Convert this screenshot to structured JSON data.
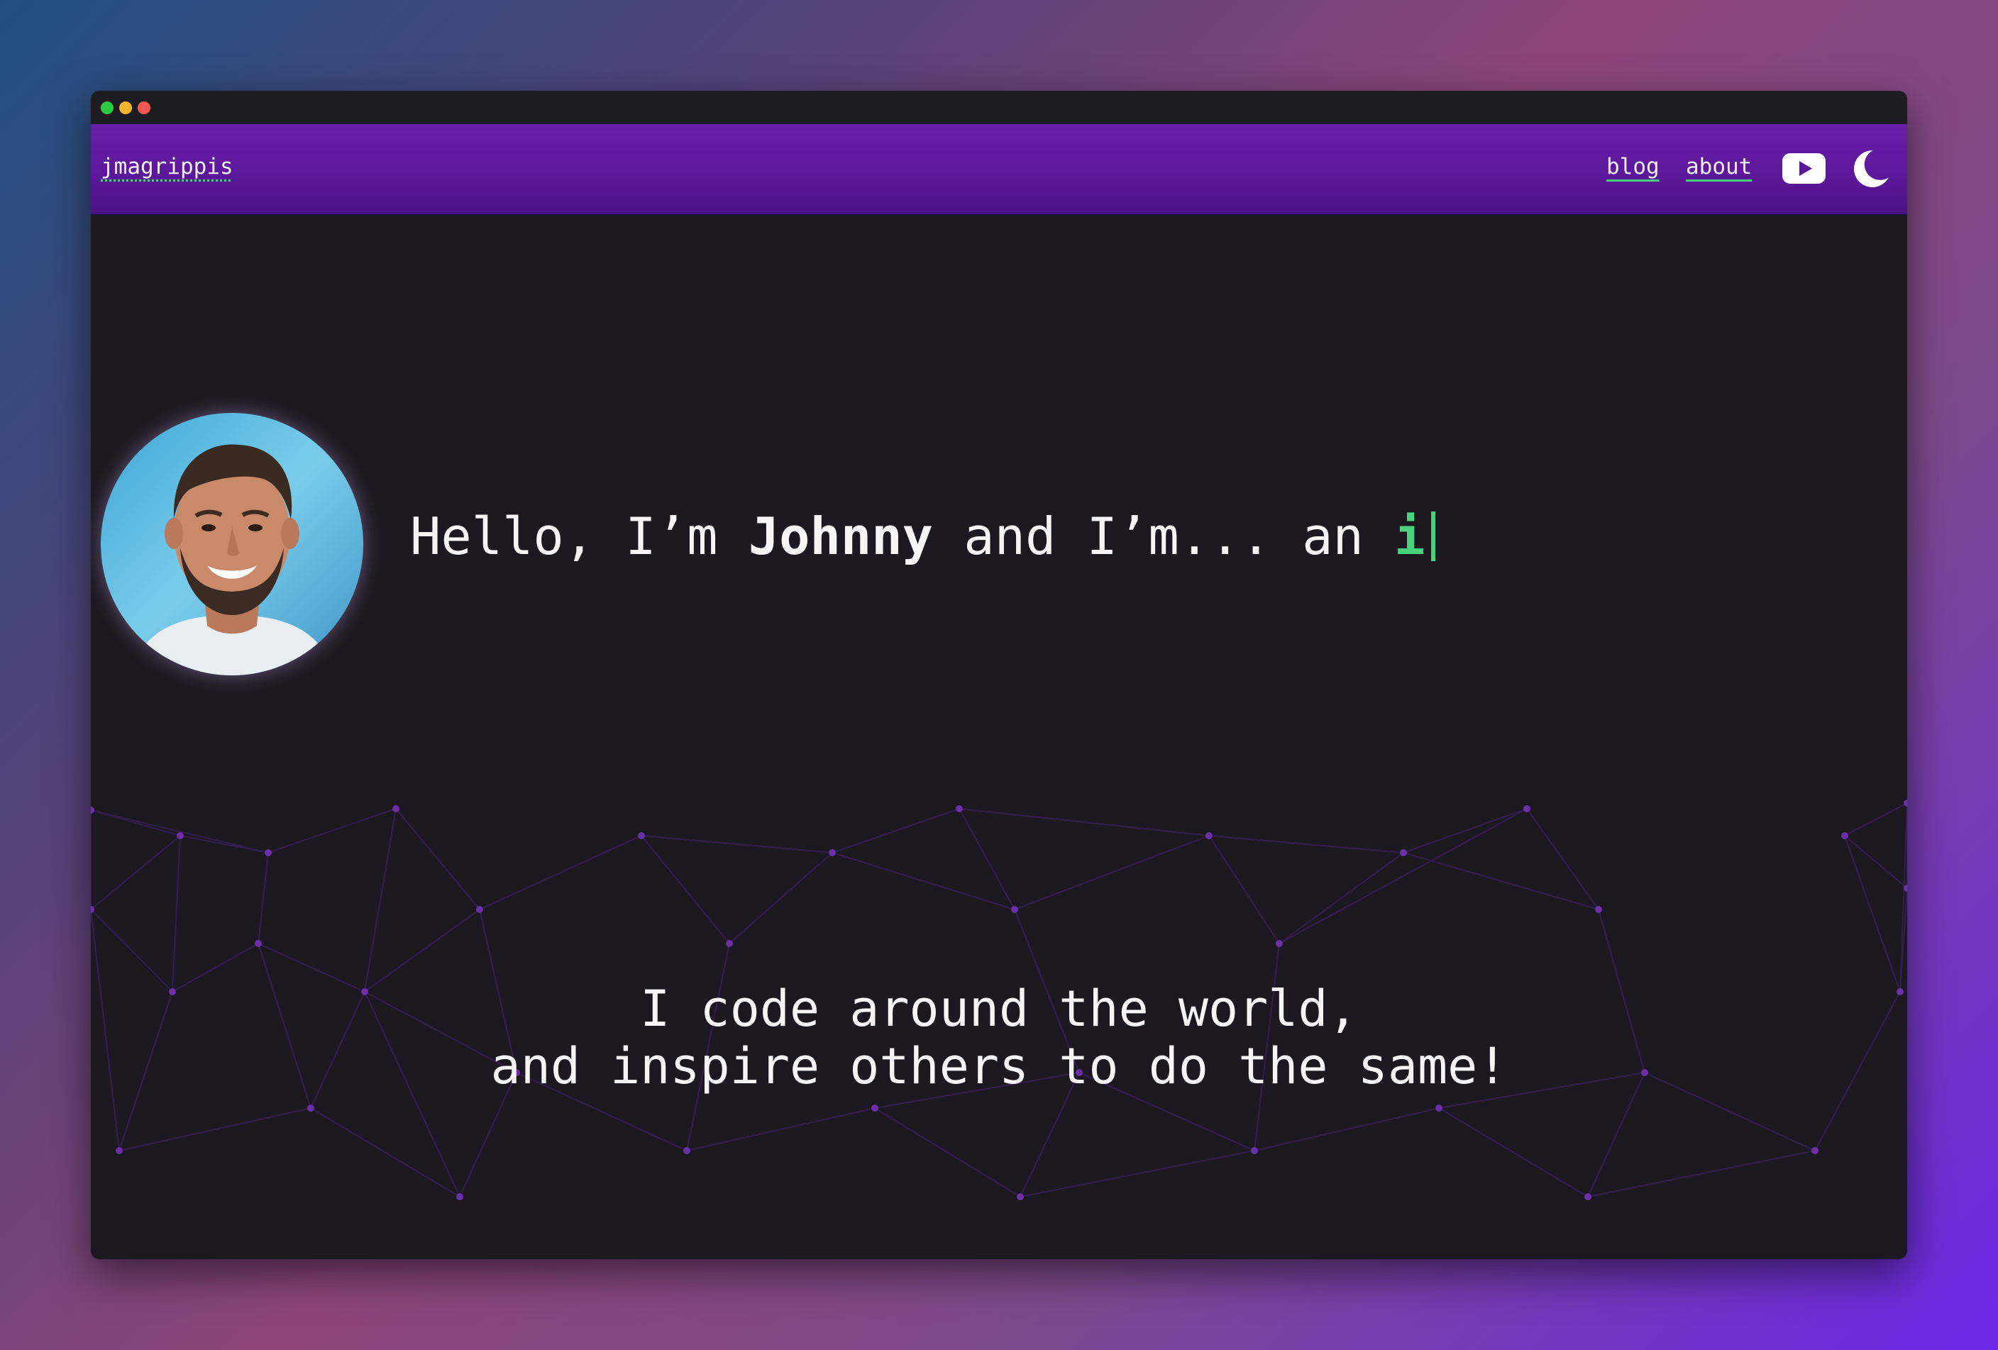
{
  "window": {
    "controls": [
      "green-dot",
      "yellow-dot",
      "red-dot"
    ]
  },
  "navbar": {
    "brand": "jmagrippis",
    "links": [
      {
        "label": "blog"
      },
      {
        "label": "about"
      }
    ],
    "icons": [
      "youtube-icon",
      "moon-icon"
    ]
  },
  "hero": {
    "greeting_prefix": "Hello, I’m ",
    "name": "Johnny",
    "greeting_middle": " and I’m... an ",
    "typed_text": "i",
    "avatar": "profile-photo"
  },
  "tagline": {
    "line1": "I code around the world,",
    "line2": "and inspire others to do the same!"
  },
  "colors": {
    "accent": "#46d37c",
    "navbar": "#5b1799",
    "background": "#1b191f"
  }
}
